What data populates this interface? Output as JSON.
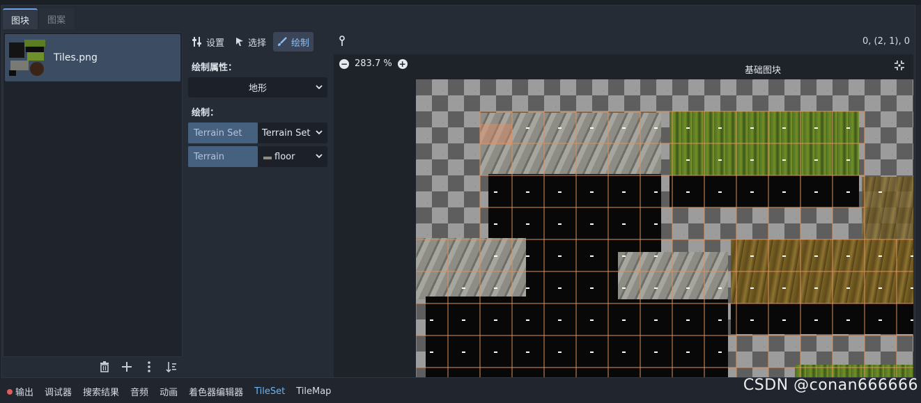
{
  "tabs": [
    {
      "label": "图块"
    },
    {
      "label": "图案"
    }
  ],
  "source_list": {
    "items": [
      {
        "label": "Tiles.png"
      }
    ]
  },
  "left_toolbar": {
    "icons": [
      "trash-icon",
      "plus-icon",
      "kebab-menu-icon",
      "sort-icon"
    ]
  },
  "modes": [
    {
      "label": "设置",
      "icon": "wrench-icon"
    },
    {
      "label": "选择",
      "icon": "cursor-icon"
    },
    {
      "label": "绘制",
      "icon": "brush-icon",
      "active": true
    }
  ],
  "paint": {
    "properties_label": "绘制属性：",
    "property_select": "地形",
    "paint_label": "绘制：",
    "terrain_set_label": "Terrain Set",
    "terrain_set_value": "Terrain Set",
    "terrain_label": "Terrain",
    "terrain_value": "floor"
  },
  "atlas": {
    "coords": "0, (2, 1), 0",
    "zoom": "283.7 %",
    "title": "基础图块",
    "tile_marker": "-"
  },
  "bottom_bar": {
    "items": [
      {
        "label": "输出",
        "status_color": "#e35c5c"
      },
      {
        "label": "调试器"
      },
      {
        "label": "搜索结果"
      },
      {
        "label": "音频"
      },
      {
        "label": "动画"
      },
      {
        "label": "着色器编辑器"
      },
      {
        "label": "TileSet",
        "active": true
      },
      {
        "label": "TileMap"
      }
    ]
  },
  "watermark": "CSDN @conan666666",
  "colors": {
    "accent": "#6fb4f2",
    "selection": "#3b4c63",
    "grid": "#e0905a"
  }
}
